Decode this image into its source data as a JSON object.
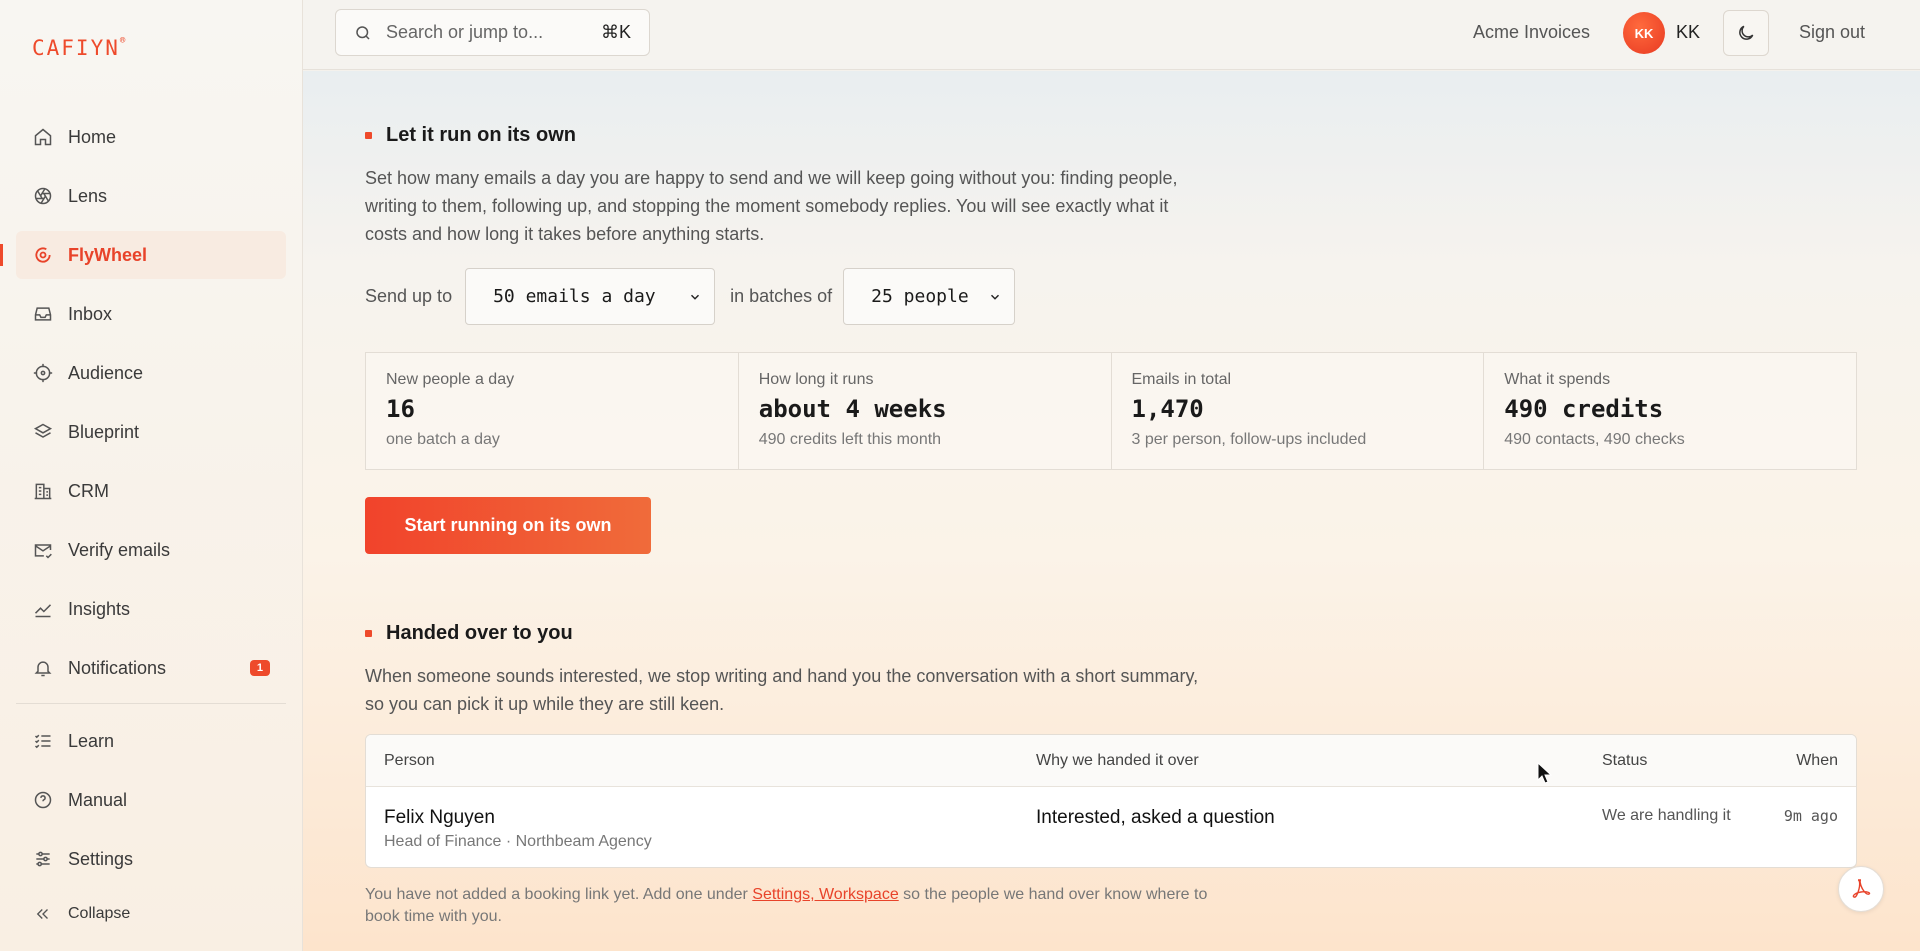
{
  "brand": {
    "logo": "CAFIYN",
    "accent": "#ee4a2b"
  },
  "sidebar": {
    "items": [
      {
        "label": "Home",
        "icon": "home-icon"
      },
      {
        "label": "Lens",
        "icon": "aperture-icon"
      },
      {
        "label": "FlyWheel",
        "icon": "flywheel-icon",
        "active": true
      },
      {
        "label": "Inbox",
        "icon": "inbox-icon"
      },
      {
        "label": "Audience",
        "icon": "crosshair-icon"
      },
      {
        "label": "Blueprint",
        "icon": "layers-icon"
      },
      {
        "label": "CRM",
        "icon": "building-icon"
      },
      {
        "label": "Verify emails",
        "icon": "mail-check-icon"
      },
      {
        "label": "Insights",
        "icon": "chart-line-icon"
      },
      {
        "label": "Notifications",
        "icon": "bell-icon",
        "badge": "1"
      }
    ],
    "secondary": [
      {
        "label": "Learn",
        "icon": "list-check-icon"
      },
      {
        "label": "Manual",
        "icon": "help-circle-icon"
      },
      {
        "label": "Settings",
        "icon": "sliders-icon"
      }
    ],
    "collapse_label": "Collapse"
  },
  "topbar": {
    "search_placeholder": "Search or jump to...",
    "search_shortcut": "⌘K",
    "workspace": "Acme Invoices",
    "avatar_initials": "KK",
    "user_initials": "KK",
    "sign_out": "Sign out"
  },
  "autorun": {
    "title": "Let it run on its own",
    "description": "Set how many emails a day you are happy to send and we will keep going without you: finding people, writing to them, following up, and stopping the moment somebody replies. You will see exactly what it costs and how long it takes before anything starts.",
    "send_up_to_label": "Send up to",
    "emails_per_day": "50 emails a day",
    "batches_label": "in batches of",
    "batch_size": "25 people",
    "stats": [
      {
        "label": "New people a day",
        "value": "16",
        "sub": "one batch a day"
      },
      {
        "label": "How long it runs",
        "value": "about 4 weeks",
        "sub": "490 credits left this month"
      },
      {
        "label": "Emails in total",
        "value": "1,470",
        "sub": "3 per person, follow-ups included"
      },
      {
        "label": "What it spends",
        "value": "490 credits",
        "sub": "490 contacts, 490 checks"
      }
    ],
    "start_button": "Start running on its own"
  },
  "handover": {
    "title": "Handed over to you",
    "description": "When someone sounds interested, we stop writing and hand you the conversation with a short summary, so you can pick it up while they are still keen.",
    "columns": {
      "person": "Person",
      "why": "Why we handed it over",
      "status": "Status",
      "when": "When"
    },
    "rows": [
      {
        "name": "Felix Nguyen",
        "role": "Head of Finance · Northbeam Agency",
        "why": "Interested, asked a question",
        "status": "We are handling it",
        "when": "9m ago"
      }
    ],
    "note_before": "You have not added a booking link yet. Add one under ",
    "note_link": "Settings, Workspace",
    "note_after": " so the people we hand over know where to book time with you."
  }
}
